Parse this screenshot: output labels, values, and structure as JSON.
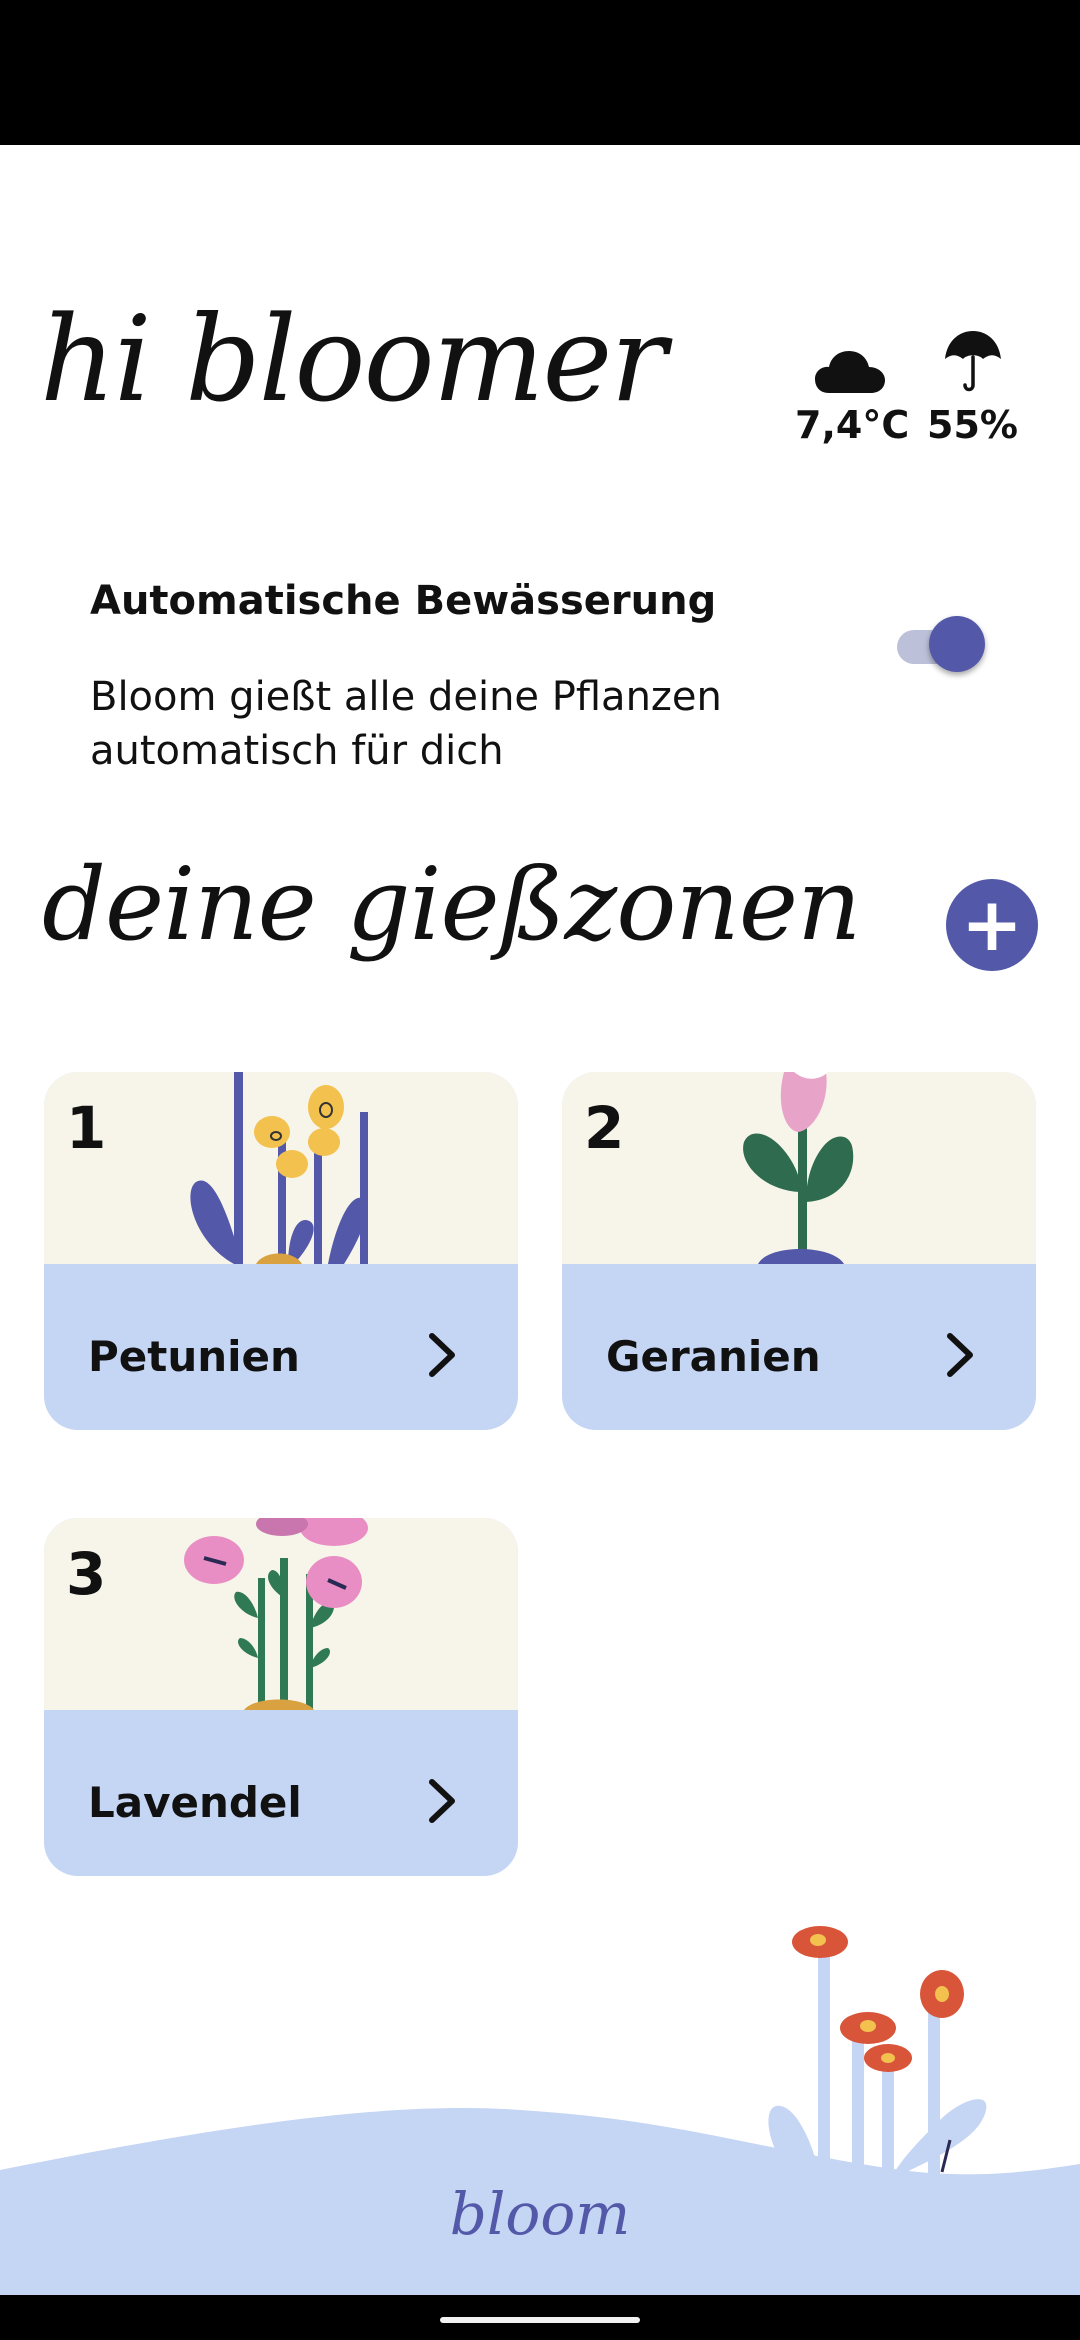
{
  "header": {
    "greeting": "hi bloomer",
    "temperature": "7,4°C",
    "humidity": "55%",
    "weather_icon": "cloud-icon",
    "humidity_icon": "umbrella-icon"
  },
  "auto_watering": {
    "title": "Automatische Bewässerung",
    "description": "Bloom gießt alle deine Pflanzen automatisch für dich",
    "enabled": true
  },
  "zones": {
    "title": "deine gießzonen",
    "add_icon": "plus-icon",
    "items": [
      {
        "number": "1",
        "name": "Petunien"
      },
      {
        "number": "2",
        "name": "Geranien"
      },
      {
        "number": "3",
        "name": "Lavendel"
      }
    ]
  },
  "footer": {
    "brand": "bloom"
  },
  "colors": {
    "accent": "#5359a8",
    "card_bottom": "#c5d5f4",
    "card_top": "#f7f5ea",
    "flower_red": "#d9553a"
  }
}
